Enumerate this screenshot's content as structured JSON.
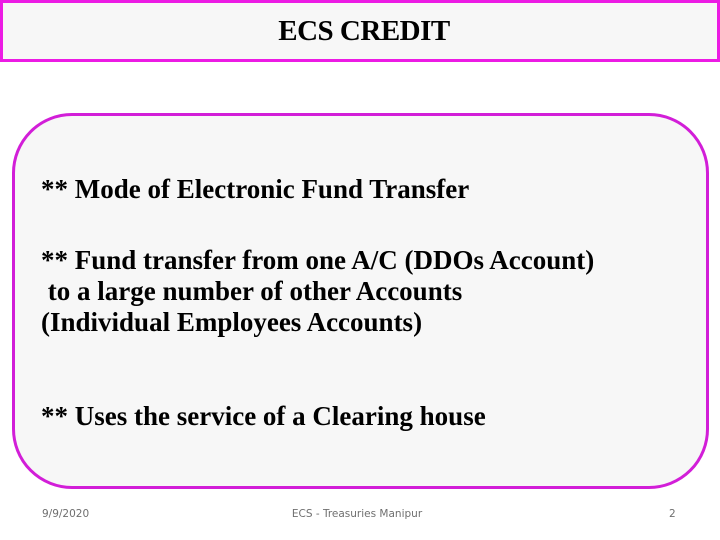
{
  "slide": {
    "title": "ECS CREDIT",
    "bullets": [
      "** Mode of Electronic Fund Transfer",
      "** Fund transfer from one A/C (DDOs Account)\n to a large number of other Accounts\n(Individual Employees Accounts)",
      "** Uses the service of a Clearing house"
    ],
    "colors": {
      "title_border": "#ec1be4",
      "content_border": "#d21ed8",
      "box_background": "#f7f7f7"
    }
  },
  "footer": {
    "date": "9/9/2020",
    "center_text": "ECS - Treasuries Manipur",
    "page_number": "2"
  }
}
